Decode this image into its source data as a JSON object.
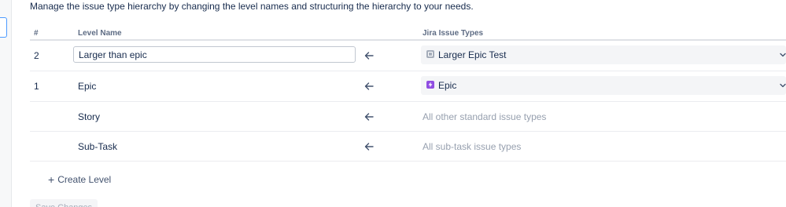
{
  "description": "Manage the issue type hierarchy by changing the level names and structuring the hierarchy to your needs.",
  "table": {
    "headers": {
      "number": "#",
      "level_name": "Level Name",
      "issue_types": "Jira Issue Types"
    },
    "rows": [
      {
        "number": "2",
        "level_name": "Larger than epic",
        "editable": true,
        "issue_type": "Larger Epic Test",
        "issue_type_icon": "gray-square-icon",
        "issue_type_color": "#a5adba"
      },
      {
        "number": "1",
        "level_name": "Epic",
        "editable": false,
        "issue_type": "Epic",
        "issue_type_icon": "epic-lightning-icon",
        "issue_type_color": "#904ee2"
      },
      {
        "number": "",
        "level_name": "Story",
        "editable": false,
        "issue_type": "All other standard issue types"
      },
      {
        "number": "",
        "level_name": "Sub-Task",
        "editable": false,
        "issue_type": "All sub-task issue types"
      }
    ]
  },
  "create_level_label": "Create Level",
  "save_button_label": "Save Changes",
  "colors": {
    "text": "#172b4d",
    "muted": "#97a0af",
    "select_bg": "#f4f5f7",
    "accent": "#4c9aff"
  }
}
